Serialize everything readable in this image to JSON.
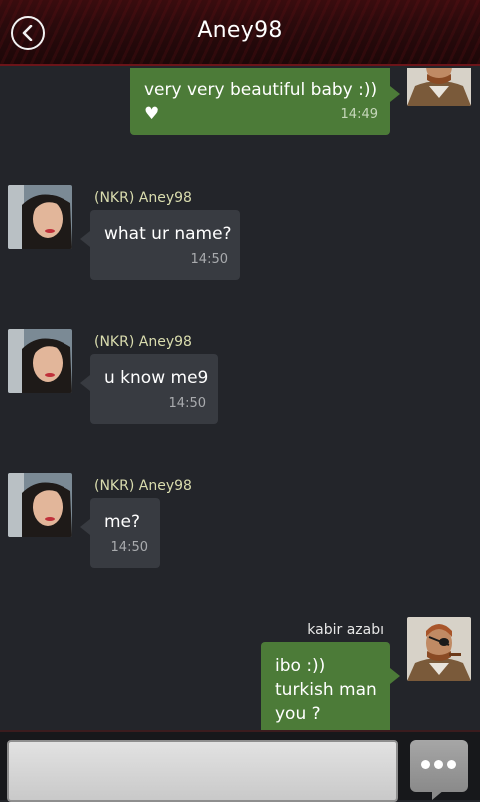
{
  "header": {
    "title": "Aney98",
    "back_icon": "chevron-left-circle-icon"
  },
  "colors": {
    "incoming_bubble": "#383b41",
    "outgoing_bubble": "#4c7b38",
    "background": "#23252a",
    "header": "#2a0a0c"
  },
  "messages": [
    {
      "direction": "out",
      "sender": "",
      "text": "very very beautiful baby :)) ♥",
      "time": "14:49"
    },
    {
      "direction": "in",
      "sender": "(NKR) Aney98",
      "text": "what ur name?",
      "time": "14:50"
    },
    {
      "direction": "in",
      "sender": "(NKR) Aney98",
      "text": "u know me9",
      "time": "14:50"
    },
    {
      "direction": "in",
      "sender": "(NKR) Aney98",
      "text": "me?",
      "time": "14:50"
    },
    {
      "direction": "out",
      "sender": "kabir azabı",
      "text": "ibo :))\nturkish man\nyou ?",
      "time": ""
    }
  ],
  "composer": {
    "placeholder": "",
    "send_icon": "chat-bubble-dots-icon"
  }
}
